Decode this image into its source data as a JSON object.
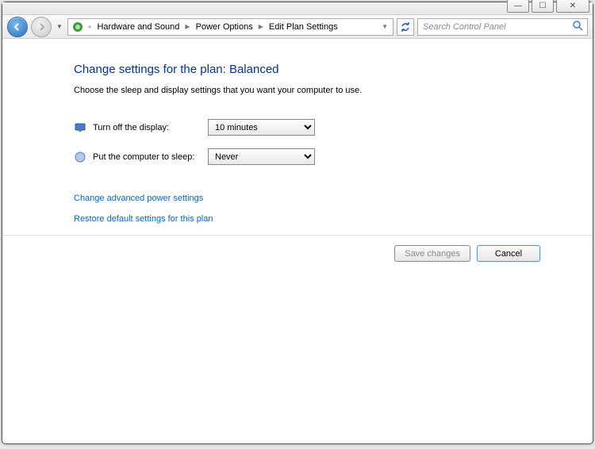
{
  "window": {
    "min_label": "—",
    "max_label": "☐",
    "close_label": "✕"
  },
  "breadcrumb": {
    "prefix": "«",
    "items": [
      "Hardware and Sound",
      "Power Options",
      "Edit Plan Settings"
    ]
  },
  "search": {
    "placeholder": "Search Control Panel"
  },
  "page": {
    "heading": "Change settings for the plan: Balanced",
    "subtext": "Choose the sleep and display settings that you want your computer to use."
  },
  "settings": {
    "display_label": "Turn off the display:",
    "display_value": "10 minutes",
    "sleep_label": "Put the computer to sleep:",
    "sleep_value": "Never"
  },
  "links": {
    "advanced": "Change advanced power settings",
    "restore": "Restore default settings for this plan"
  },
  "buttons": {
    "save": "Save changes",
    "cancel": "Cancel"
  }
}
